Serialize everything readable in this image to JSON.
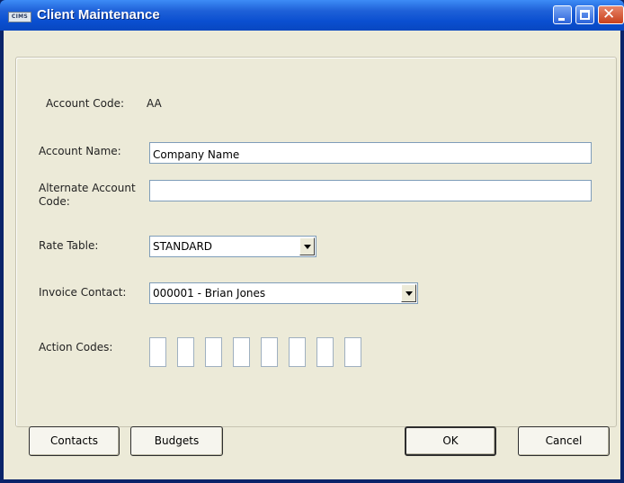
{
  "window": {
    "title": "Client Maintenance",
    "app_icon_text": "CIMS"
  },
  "form": {
    "account_code_label": "Account Code:",
    "account_code_value": "AA",
    "account_name_label": "Account Name:",
    "account_name_value": "Company Name",
    "alt_code_label_line1": "Alternate Account",
    "alt_code_label_line2": "Code:",
    "alt_code_value": "",
    "rate_table_label": "Rate Table:",
    "rate_table_value": "STANDARD",
    "invoice_contact_label": "Invoice Contact:",
    "invoice_contact_value": "000001 - Brian Jones",
    "action_codes_label": "Action Codes:",
    "action_codes": [
      "",
      "",
      "",
      "",
      "",
      "",
      "",
      ""
    ]
  },
  "buttons": {
    "contacts": "Contacts",
    "budgets": "Budgets",
    "ok": "OK",
    "cancel": "Cancel"
  },
  "colors": {
    "titlebar": "#0a4fd0",
    "dialog_bg": "#ecead8",
    "input_border": "#7f9db9"
  }
}
